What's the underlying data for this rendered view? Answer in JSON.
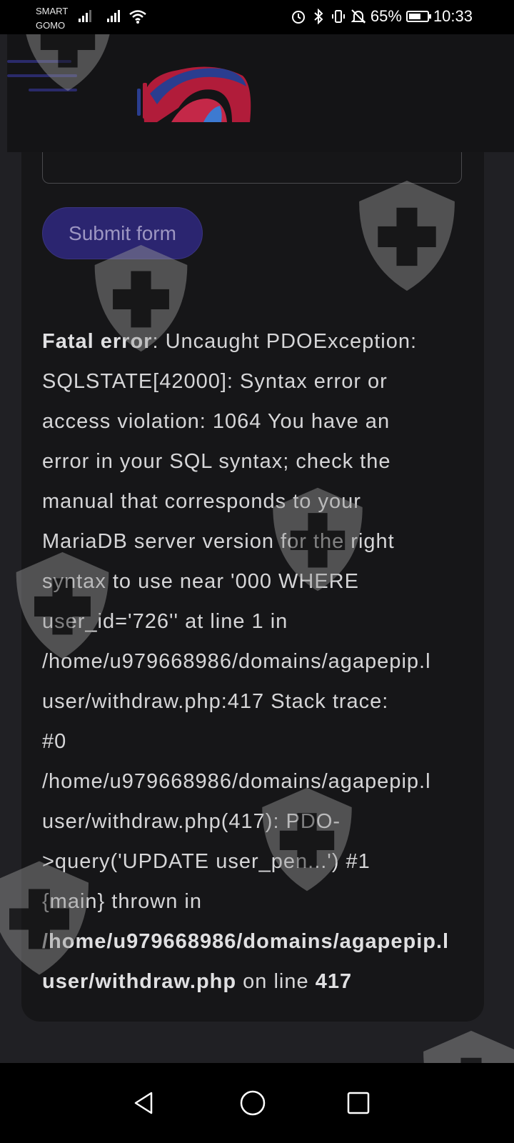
{
  "status_bar": {
    "carrier_line1": "SMART",
    "carrier_line2": "GOMO",
    "battery_percent": "65%",
    "battery_level": 0.65,
    "time": "10:33",
    "icons": [
      "signal-icon",
      "wifi-icon",
      "alarm-icon",
      "bluetooth-icon",
      "vibrate-icon",
      "mute-icon",
      "battery-icon"
    ]
  },
  "header": {
    "menu_icon": "hamburger-menu-icon",
    "logo": "brand-logo"
  },
  "form": {
    "submit_label": "Submit form"
  },
  "error": {
    "lines": [
      {
        "bold": "Fatal error",
        "text": ": Uncaught PDOException:"
      },
      {
        "text": "SQLSTATE[42000]: Syntax error or"
      },
      {
        "text": "access violation: 1064 You have an"
      },
      {
        "text": "error in your SQL syntax; check the"
      },
      {
        "text": "manual that corresponds to your"
      },
      {
        "text": "MariaDB server version for the right"
      },
      {
        "text": "syntax to use near '000 WHERE"
      },
      {
        "text": "user_id='726'' at line 1 in"
      },
      {
        "text": "/home/u979668986/domains/agapepip.l"
      },
      {
        "text": "user/withdraw.php:417 Stack trace:"
      },
      {
        "text": "#0"
      },
      {
        "text": "/home/u979668986/domains/agapepip.l"
      },
      {
        "text": "user/withdraw.php(417): PDO-"
      },
      {
        "text": ">query('UPDATE user_pen...') #1"
      },
      {
        "text": "{main} thrown in"
      },
      {
        "bold": "/home/u979668986/domains/agapepip.l"
      },
      {
        "bold": "user/withdraw.php",
        "text": " on line ",
        "bold2": "417"
      }
    ]
  },
  "navbar": {
    "back": "back-triangle-icon",
    "home": "home-circle-icon",
    "recents": "recents-square-icon"
  }
}
